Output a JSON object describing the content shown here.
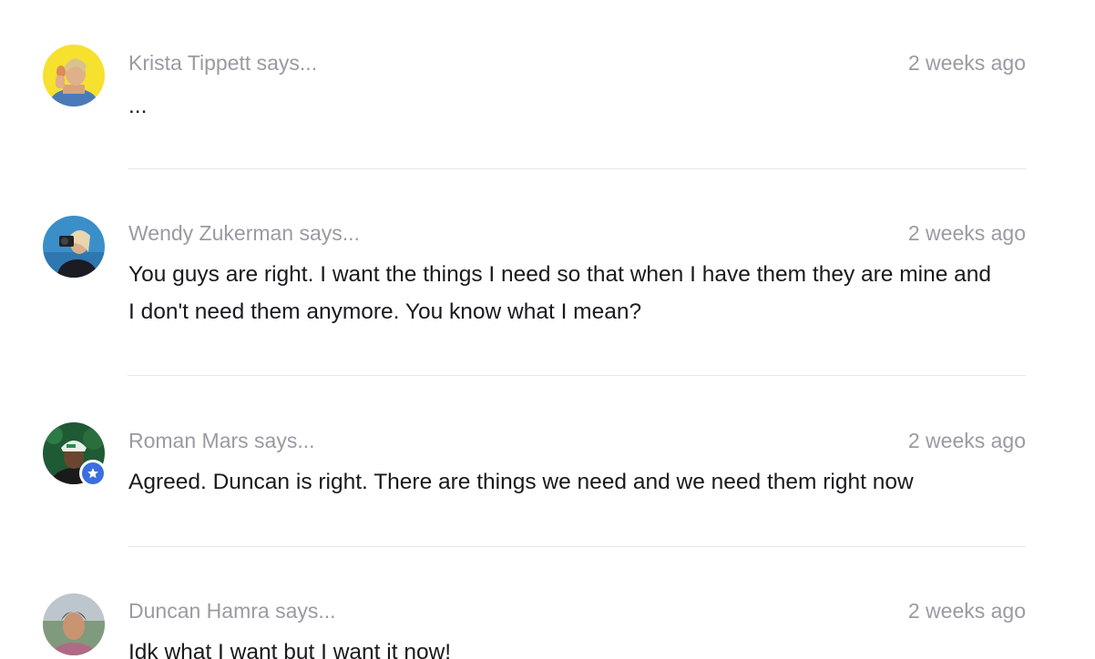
{
  "comments": [
    {
      "author": "Krista Tippett says...",
      "time": "2 weeks ago",
      "text": "...",
      "avatar_icon": "avatar-krista",
      "verified": false
    },
    {
      "author": "Wendy Zukerman says...",
      "time": "2 weeks ago",
      "text": "You guys are right. I want the things I need so that when I have them they are mine and I don't need them anymore. You know what I mean?",
      "avatar_icon": "avatar-wendy",
      "verified": false
    },
    {
      "author": "Roman Mars says...",
      "time": "2 weeks ago",
      "text": "Agreed. Duncan is right. There are things we need and we need them right now",
      "avatar_icon": "avatar-roman",
      "verified": true
    },
    {
      "author": "Duncan Hamra says...",
      "time": "2 weeks ago",
      "text": "Idk what I want but I want it now!",
      "avatar_icon": "avatar-duncan",
      "verified": false
    }
  ],
  "colors": {
    "meta_text": "#9a9aa2",
    "body_text": "#1a1a1e",
    "divider": "#e6e6ea",
    "verified_badge": "#3b6fe0"
  }
}
